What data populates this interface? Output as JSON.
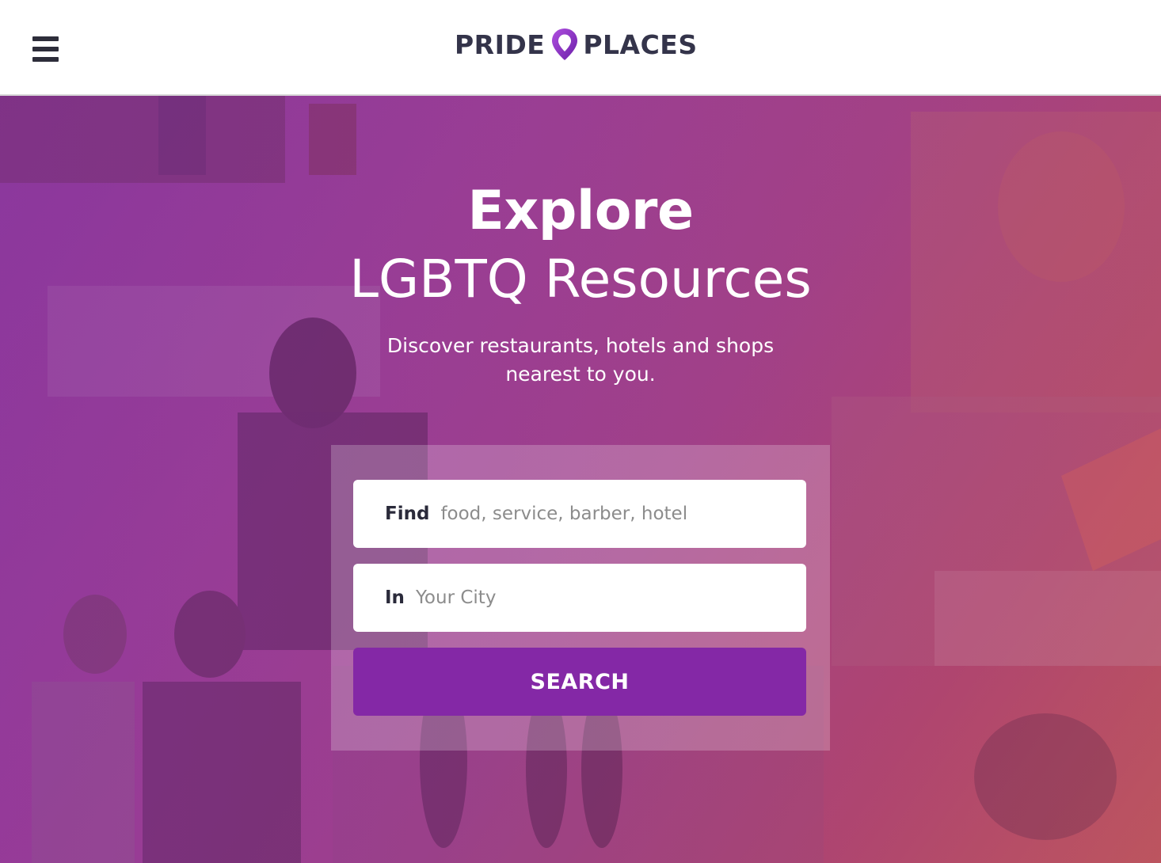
{
  "header": {
    "logo": {
      "word_left": "PRIDE",
      "word_right": "PLACES",
      "pin_color": "#8a2be2"
    },
    "menu_icon": "hamburger-menu-icon"
  },
  "hero": {
    "title_line1": "Explore",
    "title_line2": "LGBTQ Resources",
    "subtitle_line1": "Discover restaurants, hotels and shops",
    "subtitle_line2": "nearest to you.",
    "search": {
      "find_label": "Find",
      "find_placeholder": "food, service, barber, hotel",
      "find_value": "",
      "in_label": "In",
      "in_placeholder": "Your City",
      "in_value": "",
      "button_label": "SEARCH"
    }
  },
  "colors": {
    "brand_dark": "#34344a",
    "accent_purple": "#8428a6",
    "hero_gradient_start": "#8a3a9c",
    "hero_gradient_end": "#bf5a5d"
  }
}
